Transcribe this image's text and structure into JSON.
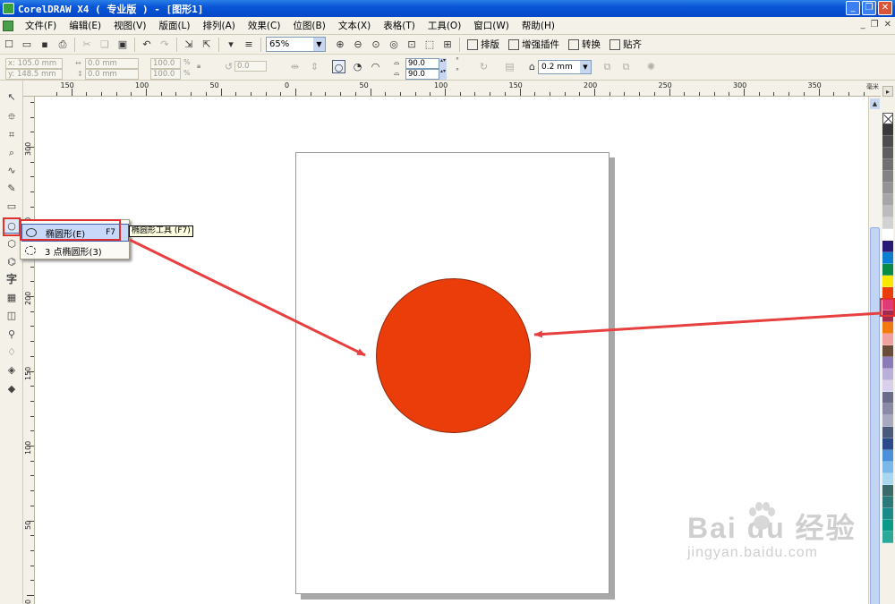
{
  "window": {
    "title": "CorelDRAW X4 ( 专业版 ) - [图形1]"
  },
  "menu": [
    "文件(F)",
    "编辑(E)",
    "视图(V)",
    "版面(L)",
    "排列(A)",
    "效果(C)",
    "位图(B)",
    "文本(X)",
    "表格(T)",
    "工具(O)",
    "窗口(W)",
    "帮助(H)"
  ],
  "toolbar": {
    "zoom": "65%",
    "buttons": [
      "排版",
      "增强插件",
      "转换",
      "贴齐"
    ]
  },
  "property_bar": {
    "x": "x: 105.0 mm",
    "y": "y: 148.5 mm",
    "w": "0.0 mm",
    "h": "0.0 mm",
    "sx": "100.0",
    "sy": "100.0",
    "pct": "%",
    "rotation": "0.0",
    "angle_start": "90.0",
    "angle_end": "90.0",
    "outline": "0.2 mm"
  },
  "ruler": {
    "unit": "毫米",
    "h_ticks": [
      "150",
      "100",
      "50",
      "0",
      "50",
      "100",
      "150",
      "200",
      "250",
      "300",
      "350"
    ],
    "v_ticks": [
      "300",
      "250",
      "200",
      "150",
      "100",
      "50",
      "0"
    ]
  },
  "flyout": {
    "items": [
      {
        "label": "椭圆形(E)",
        "shortcut": "F7",
        "selected": true
      },
      {
        "label": "3 点椭圆形(3)",
        "shortcut": "",
        "selected": false
      }
    ],
    "tooltip": "椭圆形工具 (F7)"
  },
  "shape": {
    "fill": "#ea3d0a"
  },
  "palette": [
    "none",
    "#3a3a3a",
    "#4d4d4d",
    "#5e5e5e",
    "#707070",
    "#828282",
    "#949494",
    "#a6a6a6",
    "#bcbcbc",
    "#d2d2d2",
    "#ffffff",
    "#2a1a78",
    "#0a7fd2",
    "#0a8a46",
    "#f8e800",
    "#ea3d0a",
    "#e03a78",
    "#a02a50",
    "#f07a10",
    "#f0a0a0",
    "#6a4a3a",
    "#8a7ab8",
    "#b8b0d8",
    "#d8d0ea",
    "#6a6a8a",
    "#8a8aa8",
    "#a8a8c0",
    "#4a5a7a",
    "#2a4a8a",
    "#4a90d8",
    "#7ab8e8",
    "#a8d8f0",
    "#3a6a6a",
    "#2a7a7a",
    "#1a8a8a",
    "#0a9a8a",
    "#2aa89a"
  ],
  "watermark": {
    "main": "Bai du 经验",
    "sub": "jingyan.baidu.com"
  }
}
